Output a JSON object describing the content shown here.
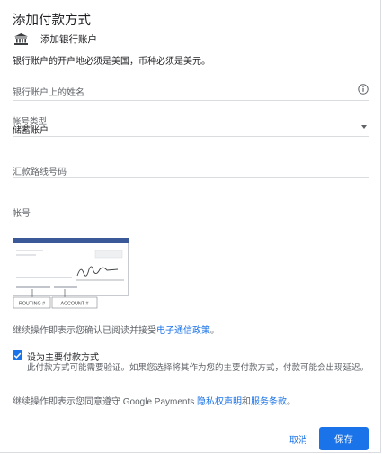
{
  "dialog": {
    "title": "添加付款方式",
    "bank_option": "添加银行账户",
    "notice": "银行账户的开户地必须是美国，币种必须是美元。"
  },
  "form": {
    "account_name_placeholder": "银行账户上的姓名",
    "account_type_label": "帐号类型",
    "account_type_value": "储蓄账户",
    "routing_placeholder": "汇款路线号码",
    "account_number_placeholder": "帐号"
  },
  "check_image": {
    "routing_label": "ROUTING #",
    "account_label": "ACCOUNT #"
  },
  "consent": {
    "text": "继续操作即表示您确认已阅读并接受",
    "link": "电子通信政策",
    "end": "。"
  },
  "primary": {
    "label": "设为主要付款方式",
    "description": "此付款方式可能需要验证。如果您选择将其作为您的主要付款方式，付款可能会出现延迟。"
  },
  "terms": {
    "prefix": "继续操作即表示您同意遵守 Google Payments ",
    "privacy_link": "隐私权声明",
    "and": "和",
    "tos_link": "服务条款",
    "end": "。"
  },
  "buttons": {
    "cancel": "取消",
    "save": "保存"
  },
  "colors": {
    "accent": "#1a73e8",
    "check_header": "#3b5998"
  },
  "icons": {
    "bank": "bank-icon",
    "info": "info-icon",
    "dropdown": "chevron-down-icon",
    "checkbox": "checkmark-icon"
  }
}
